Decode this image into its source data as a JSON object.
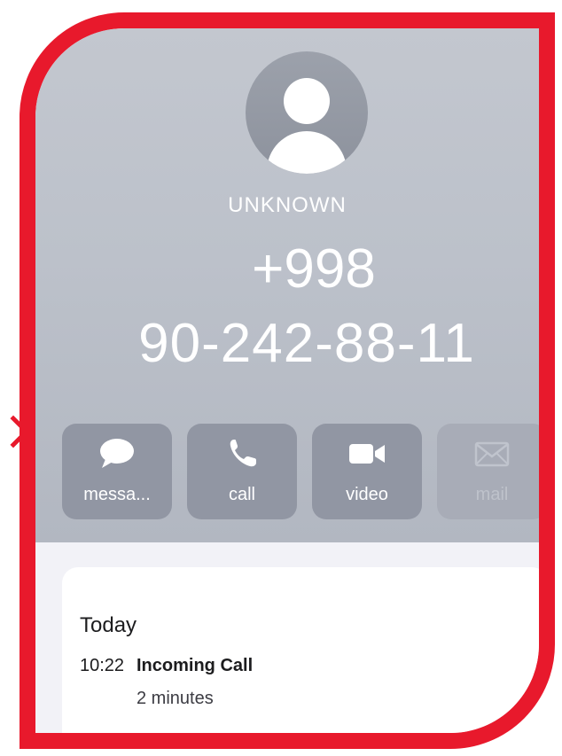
{
  "contact": {
    "name_label": "UNKNOWN",
    "phone_line1": "+998",
    "phone_line2": "90-242-88-11"
  },
  "actions": [
    {
      "label": "messa...",
      "icon": "message-bubble-icon",
      "enabled": true
    },
    {
      "label": "call",
      "icon": "phone-icon",
      "enabled": true
    },
    {
      "label": "video",
      "icon": "video-camera-icon",
      "enabled": true
    },
    {
      "label": "mail",
      "icon": "envelope-icon",
      "enabled": false
    }
  ],
  "history": {
    "day": "Today",
    "entries": [
      {
        "time": "10:22",
        "type": "Incoming Call",
        "duration": "2 minutes"
      }
    ]
  },
  "colors": {
    "frame_red": "#e8192c",
    "header_gray": "#bcc1ca",
    "button_gray": "#9196a3",
    "card_white": "#ffffff"
  }
}
